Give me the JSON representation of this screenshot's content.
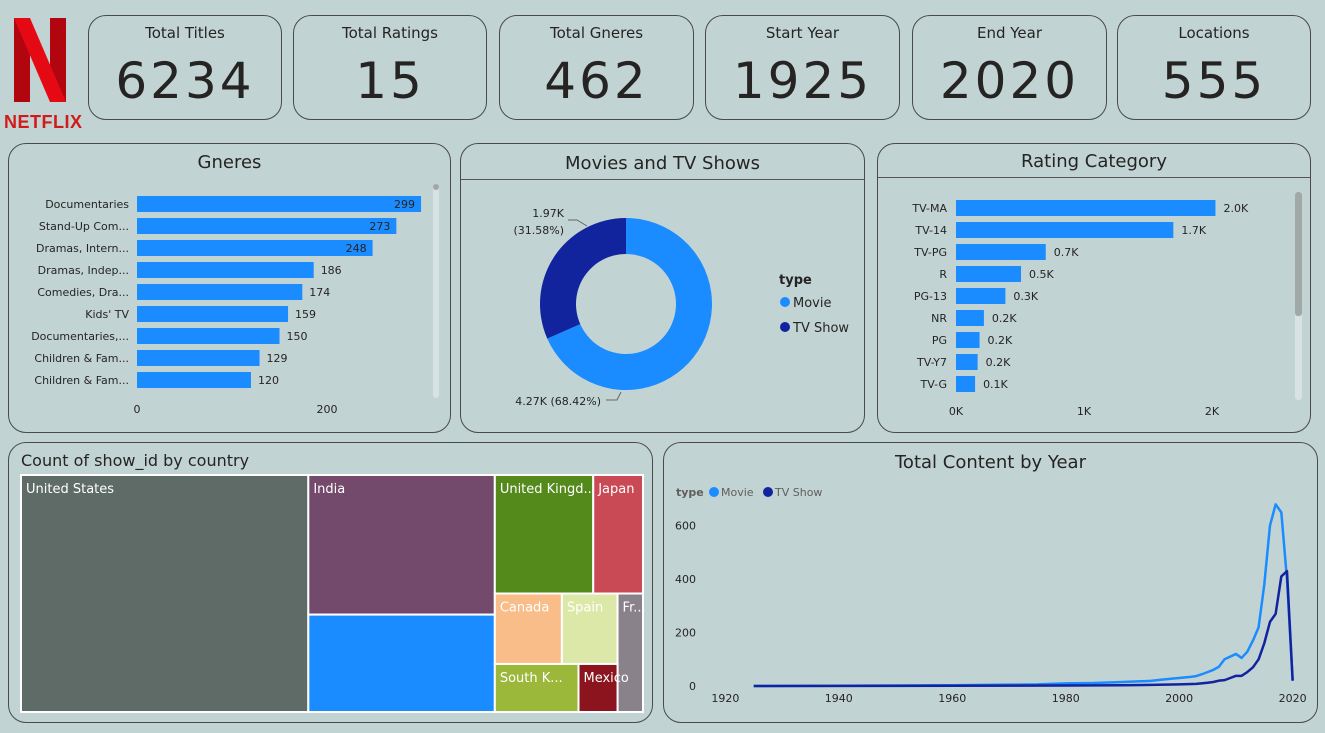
{
  "brand": {
    "logo_text": "NETFLIX",
    "logo_color": "#d11b1b"
  },
  "kpis": [
    {
      "label": "Total Titles",
      "value": "6234"
    },
    {
      "label": "Total Ratings",
      "value": "15"
    },
    {
      "label": "Total Gneres",
      "value": "462"
    },
    {
      "label": "Start Year",
      "value": "1925"
    },
    {
      "label": "End Year",
      "value": "2020"
    },
    {
      "label": "Locations",
      "value": "555"
    }
  ],
  "colors": {
    "bar": "#1a8cff",
    "movie": "#1a8cff",
    "tv": "#12239e",
    "background": "#c2d3d4"
  },
  "chart_data": [
    {
      "id": "genres",
      "type": "bar",
      "orientation": "horizontal",
      "title": "Gneres",
      "categories": [
        "Documentaries",
        "Stand-Up Com...",
        "Dramas, Intern...",
        "Dramas, Indep...",
        "Comedies, Dra...",
        "Kids' TV",
        "Documentaries,...",
        "Children & Fam...",
        "Children & Fam..."
      ],
      "values": [
        299,
        273,
        248,
        186,
        174,
        159,
        150,
        129,
        120
      ],
      "xticks": [
        "0",
        "200"
      ],
      "xlim": [
        0,
        300
      ]
    },
    {
      "id": "types",
      "type": "pie",
      "title": "Movies and TV Shows",
      "legend_title": "type",
      "legend_position": "right",
      "slices": [
        {
          "name": "Movie",
          "value": 4265,
          "label": "4.27K (68.42%)",
          "color": "#1a8cff"
        },
        {
          "name": "TV Show",
          "value": 1969,
          "label": "1.97K (31.58%)",
          "color": "#12239e"
        }
      ]
    },
    {
      "id": "ratings",
      "type": "bar",
      "orientation": "horizontal",
      "title": "Rating Category",
      "categories": [
        "TV-MA",
        "TV-14",
        "TV-PG",
        "R",
        "PG-13",
        "NR",
        "PG",
        "TV-Y7",
        "TV-G"
      ],
      "values": [
        2027,
        1698,
        701,
        508,
        386,
        218,
        184,
        169,
        149
      ],
      "labels": [
        "2.0K",
        "1.7K",
        "0.7K",
        "0.5K",
        "0.3K",
        "0.2K",
        "0.2K",
        "0.2K",
        "0.1K"
      ],
      "xticks": [
        "0K",
        "1K",
        "2K"
      ],
      "xlim": [
        0,
        2500
      ]
    },
    {
      "id": "countries",
      "type": "treemap",
      "title": "Count of show_id by country",
      "items": [
        {
          "name": "United States",
          "label": "United States",
          "value": 2032,
          "color": "#5f6b66"
        },
        {
          "name": "India",
          "label": "India",
          "value": 777,
          "color": "#744a6c"
        },
        {
          "name": "",
          "label": "",
          "value": 542,
          "color": "#1a8cff"
        },
        {
          "name": "United Kingdom",
          "label": "United Kingd...",
          "value": 348,
          "color": "#548a1c"
        },
        {
          "name": "Japan",
          "label": "Japan",
          "value": 176,
          "color": "#c94a55"
        },
        {
          "name": "Canada",
          "label": "Canada",
          "value": 141,
          "color": "#f8bd88"
        },
        {
          "name": "Spain",
          "label": "Spain",
          "value": 117,
          "color": "#dce8a8"
        },
        {
          "name": "France",
          "label": "Fr...",
          "value": 90,
          "color": "#8a828b"
        },
        {
          "name": "South Korea",
          "label": "South K...",
          "value": 120,
          "color": "#9bb83a"
        },
        {
          "name": "Mexico",
          "label": "Mexico",
          "value": 56,
          "color": "#8b141e"
        }
      ]
    },
    {
      "id": "content_by_year",
      "type": "line",
      "title": "Total Content by Year",
      "legend_title": "type",
      "legend_position": "top-left",
      "xlim": [
        1918,
        2022
      ],
      "ylim": [
        0,
        700
      ],
      "xticks": [
        1920,
        1940,
        1960,
        1980,
        2000,
        2020
      ],
      "yticks": [
        0,
        200,
        400,
        600
      ],
      "series": [
        {
          "name": "Movie",
          "color": "#1a8cff",
          "points": [
            [
              1925,
              0
            ],
            [
              1940,
              1
            ],
            [
              1950,
              2
            ],
            [
              1960,
              3
            ],
            [
              1970,
              5
            ],
            [
              1975,
              6
            ],
            [
              1980,
              10
            ],
            [
              1985,
              11
            ],
            [
              1990,
              15
            ],
            [
              1995,
              19
            ],
            [
              1997,
              24
            ],
            [
              1999,
              28
            ],
            [
              2000,
              30
            ],
            [
              2002,
              34
            ],
            [
              2003,
              37
            ],
            [
              2004,
              44
            ],
            [
              2005,
              52
            ],
            [
              2006,
              60
            ],
            [
              2007,
              72
            ],
            [
              2008,
              100
            ],
            [
              2009,
              110
            ],
            [
              2010,
              120
            ],
            [
              2011,
              105
            ],
            [
              2012,
              128
            ],
            [
              2013,
              170
            ],
            [
              2014,
              220
            ],
            [
              2015,
              380
            ],
            [
              2016,
              600
            ],
            [
              2017,
              680
            ],
            [
              2018,
              650
            ],
            [
              2019,
              400
            ],
            [
              2020,
              20
            ]
          ]
        },
        {
          "name": "TV Show",
          "color": "#12239e",
          "points": [
            [
              1925,
              0
            ],
            [
              1960,
              1
            ],
            [
              1980,
              2
            ],
            [
              1990,
              3
            ],
            [
              1995,
              4
            ],
            [
              2000,
              6
            ],
            [
              2003,
              8
            ],
            [
              2005,
              12
            ],
            [
              2006,
              15
            ],
            [
              2007,
              20
            ],
            [
              2008,
              22
            ],
            [
              2009,
              30
            ],
            [
              2010,
              38
            ],
            [
              2011,
              38
            ],
            [
              2012,
              52
            ],
            [
              2013,
              70
            ],
            [
              2014,
              100
            ],
            [
              2015,
              160
            ],
            [
              2016,
              240
            ],
            [
              2017,
              270
            ],
            [
              2018,
              410
            ],
            [
              2019,
              430
            ],
            [
              2020,
              20
            ]
          ]
        }
      ]
    }
  ]
}
